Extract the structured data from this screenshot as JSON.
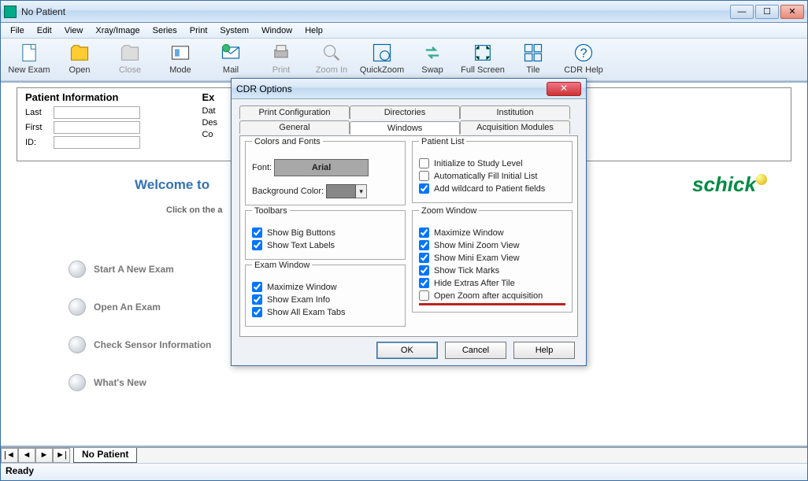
{
  "window": {
    "title": "No Patient"
  },
  "menubar": [
    "File",
    "Edit",
    "View",
    "Xray/Image",
    "Series",
    "Print",
    "System",
    "Window",
    "Help"
  ],
  "toolbar": [
    {
      "label": "New Exam",
      "icon": "page",
      "disabled": false
    },
    {
      "label": "Open",
      "icon": "folder",
      "disabled": false
    },
    {
      "label": "Close",
      "icon": "closefolder",
      "disabled": true
    },
    {
      "label": "Mode",
      "icon": "mode",
      "disabled": false
    },
    {
      "label": "Mail",
      "icon": "mail",
      "disabled": false
    },
    {
      "label": "Print",
      "icon": "print",
      "disabled": true
    },
    {
      "label": "Zoom In",
      "icon": "zoomin",
      "disabled": true
    },
    {
      "label": "QuickZoom",
      "icon": "quickzoom",
      "disabled": false
    },
    {
      "label": "Swap",
      "icon": "swap",
      "disabled": false
    },
    {
      "label": "Full Screen",
      "icon": "fullscreen",
      "disabled": false
    },
    {
      "label": "Tile",
      "icon": "tile",
      "disabled": false
    },
    {
      "label": "CDR Help",
      "icon": "help",
      "disabled": false
    }
  ],
  "patient_info": {
    "heading": "Patient Information",
    "labels": {
      "last": "Last",
      "first": "First",
      "id": "ID:"
    },
    "exam_heading_frag": "Ex",
    "exam_labels": {
      "date": "Dat",
      "desc": "Des",
      "comment": "Co"
    }
  },
  "welcome": {
    "title_frag": "Welcome to",
    "sub_frag": "Click on the a"
  },
  "quicklinks": [
    "Start A New Exam",
    "Open An Exam",
    "Check Sensor Information",
    "What's New"
  ],
  "tabs_bottom": {
    "name": "No Patient"
  },
  "statusbar": "Ready",
  "logo": "schick",
  "dialog": {
    "title": "CDR Options",
    "tabs_row1": [
      "Print Configuration",
      "Directories",
      "Institution"
    ],
    "tabs_row2": [
      "General",
      "Windows",
      "Acquisition Modules"
    ],
    "active_tab": "Windows",
    "colors_fonts": {
      "legend": "Colors and Fonts",
      "font_label": "Font:",
      "font_value": "Arial",
      "bg_label": "Background Color:"
    },
    "patient_list": {
      "legend": "Patient List",
      "items": [
        {
          "label": "Initialize to Study Level",
          "checked": false
        },
        {
          "label": "Automatically Fill Initial List",
          "checked": false
        },
        {
          "label": "Add wildcard to Patient fields",
          "checked": true
        }
      ]
    },
    "toolbars": {
      "legend": "Toolbars",
      "items": [
        {
          "label": "Show Big Buttons",
          "checked": true
        },
        {
          "label": "Show Text Labels",
          "checked": true
        }
      ]
    },
    "exam_window": {
      "legend": "Exam Window",
      "items": [
        {
          "label": "Maximize Window",
          "checked": true
        },
        {
          "label": "Show Exam Info",
          "checked": true
        },
        {
          "label": "Show All Exam Tabs",
          "checked": true
        }
      ]
    },
    "zoom_window": {
      "legend": "Zoom Window",
      "items": [
        {
          "label": "Maximize Window",
          "checked": true
        },
        {
          "label": "Show Mini Zoom View",
          "checked": true
        },
        {
          "label": "Show Mini Exam View",
          "checked": true
        },
        {
          "label": "Show Tick Marks",
          "checked": true
        },
        {
          "label": "Hide Extras After Tile",
          "checked": true
        },
        {
          "label": "Open Zoom after acquisition",
          "checked": false
        }
      ]
    },
    "buttons": {
      "ok": "OK",
      "cancel": "Cancel",
      "help": "Help"
    }
  }
}
